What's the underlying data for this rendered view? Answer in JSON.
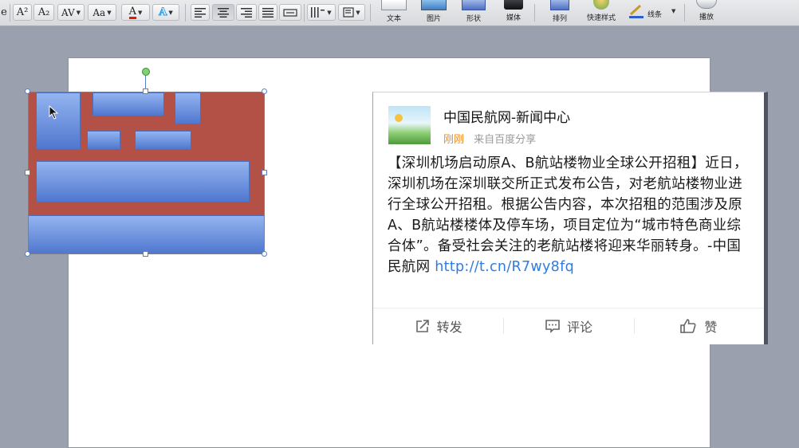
{
  "ribbon": {
    "buttons": [
      {
        "id": "superscript",
        "label": "A²"
      },
      {
        "id": "subscript",
        "label": "A₂"
      },
      {
        "id": "char-spacing",
        "label": "AV"
      },
      {
        "id": "change-case",
        "label": "Aa"
      },
      {
        "id": "font-color",
        "label": "A"
      },
      {
        "id": "text-effects",
        "label": "A"
      }
    ],
    "big": {
      "text_box": "文本",
      "picture": "图片",
      "shape": "形状",
      "media": "媒体",
      "arrange": "排列",
      "quick_styles": "快速样式",
      "line": "线条",
      "play": "播放"
    },
    "colors": {
      "font_color": "#d81e06",
      "text_effect": "#3aa3e6"
    }
  },
  "weibo": {
    "user": "中国民航网-新闻中心",
    "time": "刚刚",
    "source": "来自百度分享",
    "text": "【深圳机场启动原A、B航站楼物业全球公开招租】近日，深圳机场在深圳联交所正式发布公告，对老航站楼物业进行全球公开招租。根据公告内容，本次招租的范围涉及原A、B航站楼楼体及停车场，项目定位为“城市特色商业综合体”。备受社会关注的老航站楼将迎来华丽转身。-中国民航网 ",
    "link": "http://t.cn/R7wy8fq",
    "actions": {
      "repost": "转发",
      "comment": "评论",
      "like": "赞"
    }
  }
}
